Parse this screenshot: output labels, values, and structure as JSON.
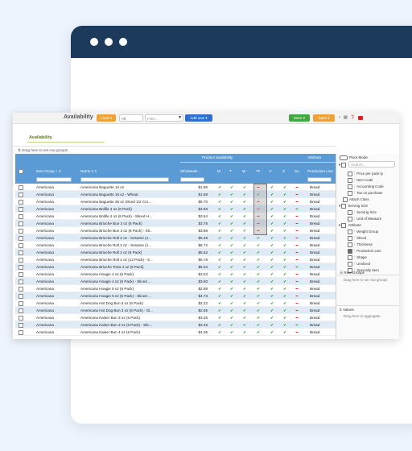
{
  "toolbar": {
    "title": "Availability",
    "load_label": "Load ▾",
    "scope_value": "All",
    "filter_placeholder": "Filter...",
    "add_new_label": "Add new ▾",
    "more_label": "More ▾",
    "save_label": "Save ▾"
  },
  "tab": {
    "label": "Availability"
  },
  "drag_hint": "Drag here to set row groups",
  "grid": {
    "group_headers": {
      "product_availability": "Product availability",
      "attribute": "Attribute"
    },
    "headers": {
      "item_group": "Item Group ↑ ≡",
      "name": "Name ≡ ≡",
      "wholesale": "Wholesale...",
      "days": [
        "M",
        "T",
        "W",
        "Th",
        "F",
        "S",
        "Su"
      ],
      "production_line": "Production Line"
    },
    "rows": [
      {
        "group": "Americana",
        "name": "Americana Baguette 12 oz",
        "price": "$1.80",
        "days": [
          "y",
          "y",
          "y",
          "n",
          "y",
          "y",
          "n"
        ],
        "line": "Bread"
      },
      {
        "group": "Americana",
        "name": "Americana Baguette 16 oz - Wheat",
        "price": "$1.58",
        "days": [
          "y",
          "y",
          "y",
          "y",
          "y",
          "y",
          "n"
        ],
        "line": "Bread"
      },
      {
        "group": "Americana",
        "name": "Americana Baguette 36 oz Sliced 1/2 Cro...",
        "price": "$5.70",
        "days": [
          "y",
          "y",
          "y",
          "n",
          "y",
          "y",
          "n"
        ],
        "line": "Bread"
      },
      {
        "group": "Americana",
        "name": "Americana Bolillo 4 oz (6 Pack)",
        "price": "$3.66",
        "days": [
          "y",
          "y",
          "y",
          "n",
          "y",
          "y",
          "n"
        ],
        "line": "Bread"
      },
      {
        "group": "Americana",
        "name": "Americana Bolillo 4 oz (6 Pack) - Sliced H...",
        "price": "$3.64",
        "days": [
          "y",
          "y",
          "y",
          "n",
          "y",
          "y",
          "n"
        ],
        "line": "Bread"
      },
      {
        "group": "Americana",
        "name": "Americana Brioche Bun 3 oz (6 Pack)",
        "price": "$3.78",
        "days": [
          "y",
          "y",
          "y",
          "n",
          "y",
          "y",
          "n"
        ],
        "line": "Bread"
      },
      {
        "group": "Americana",
        "name": "Americana Brioche Bun 3 oz (6 Pack) - Sli...",
        "price": "$3.96",
        "days": [
          "y",
          "y",
          "y",
          "n",
          "y",
          "y",
          "n"
        ],
        "line": "Bread"
      },
      {
        "group": "Americana",
        "name": "Americana Brioche Roll 2 oz - Sesame (1...",
        "price": "$6.48",
        "days": [
          "y",
          "y",
          "y",
          "y",
          "y",
          "y",
          "n"
        ],
        "line": "Bread"
      },
      {
        "group": "Americana",
        "name": "Americana Brioche Roll 2 oz - Sesame (1...",
        "price": "$6.72",
        "days": [
          "y",
          "y",
          "y",
          "y",
          "y",
          "y",
          "n"
        ],
        "line": "Bread"
      },
      {
        "group": "Americana",
        "name": "Americana Brioche Roll 2 oz (6 Pack)",
        "price": "$5.52",
        "days": [
          "y",
          "y",
          "y",
          "y",
          "y",
          "y",
          "n"
        ],
        "line": "Bread"
      },
      {
        "group": "Americana",
        "name": "Americana Brioche Roll 2 oz (12 Pack) - S...",
        "price": "$5.78",
        "days": [
          "y",
          "y",
          "y",
          "y",
          "y",
          "y",
          "n"
        ],
        "line": "Bread"
      },
      {
        "group": "Americana",
        "name": "Americana Brioche Torta 4 oz (6 Pack)",
        "price": "$5.04",
        "days": [
          "y",
          "y",
          "y",
          "y",
          "y",
          "y",
          "n"
        ],
        "line": "Bread"
      },
      {
        "group": "Americana",
        "name": "Americana Hoagie 4 oz (6 Pack)",
        "price": "$3.53",
        "days": [
          "y",
          "y",
          "y",
          "y",
          "y",
          "y",
          "n"
        ],
        "line": "Bread"
      },
      {
        "group": "Americana",
        "name": "Americana Hoagie 4 oz (6 Pack) - Sliced ...",
        "price": "$3.60",
        "days": [
          "y",
          "y",
          "y",
          "y",
          "y",
          "y",
          "n"
        ],
        "line": "Bread"
      },
      {
        "group": "Americana",
        "name": "Americana Hoagie 5 oz (6 Pack)",
        "price": "$2.98",
        "days": [
          "y",
          "y",
          "y",
          "y",
          "y",
          "y",
          "n"
        ],
        "line": "Bread"
      },
      {
        "group": "Americana",
        "name": "Americana Hoagie 5 oz (6 Pack) - Sliced ...",
        "price": "$4.73",
        "days": [
          "y",
          "y",
          "y",
          "y",
          "y",
          "y",
          "n"
        ],
        "line": "Bread"
      },
      {
        "group": "Americana",
        "name": "Americana Hot Dog Bun 3 oz (6 Pack)",
        "price": "$2.22",
        "days": [
          "y",
          "y",
          "y",
          "y",
          "y",
          "y",
          "n"
        ],
        "line": "Bread"
      },
      {
        "group": "Americana",
        "name": "Americana Hot Dog Bun 3 oz (6 Pack) - Sl...",
        "price": "$2.65",
        "days": [
          "y",
          "y",
          "y",
          "y",
          "y",
          "y",
          "n"
        ],
        "line": "Bread"
      },
      {
        "group": "Americana",
        "name": "Americana Kaiser Bun 3 oz (6 Pack)",
        "price": "$3.25",
        "days": [
          "y",
          "y",
          "y",
          "y",
          "y",
          "y",
          "n"
        ],
        "line": "Bread"
      },
      {
        "group": "Americana",
        "name": "Americana Kaiser Bun 3 oz (6 Pack) - Slic...",
        "price": "$3.45",
        "days": [
          "y",
          "y",
          "y",
          "y",
          "y",
          "y",
          "n"
        ],
        "line": "Bread"
      },
      {
        "group": "Americana",
        "name": "Americana Kaiser Bun 4 oz (6 Pack)",
        "price": "$4.35",
        "days": [
          "y",
          "y",
          "y",
          "y",
          "y",
          "y",
          "n"
        ],
        "line": "Bread"
      }
    ]
  },
  "panel": {
    "pivot_mode": "Pivot Mode",
    "search_placeholder": "Search...",
    "items": [
      {
        "label": "Price per pack ty",
        "checked": false,
        "level": 3
      },
      {
        "label": "Item Code",
        "checked": false,
        "level": 3
      },
      {
        "label": "Accounting Code",
        "checked": false,
        "level": 3
      },
      {
        "label": "Tax on purchase",
        "checked": false,
        "level": 3
      },
      {
        "label": "Attach Class",
        "checked": false,
        "level": 2
      },
      {
        "label": "Serving Size",
        "checked": false,
        "level": 1
      },
      {
        "label": "Serving Size",
        "checked": false,
        "level": 3
      },
      {
        "label": "Unit of Measure",
        "checked": false,
        "level": 3
      },
      {
        "label": "Attribute",
        "checked": false,
        "level": 1
      },
      {
        "label": "Weight Group",
        "checked": false,
        "level": 3
      },
      {
        "label": "Sliced",
        "checked": false,
        "level": 3
      },
      {
        "label": "Thickness",
        "checked": false,
        "level": 3
      },
      {
        "label": "Production Line",
        "checked": true,
        "level": 3
      },
      {
        "label": "Shape",
        "checked": false,
        "level": 3
      },
      {
        "label": "Unsliced",
        "checked": false,
        "level": 3
      },
      {
        "label": "Specialty Item",
        "checked": false,
        "level": 3
      }
    ],
    "row_groups_label": "Row Groups",
    "row_groups_hint": "Drag here to set row groups",
    "values_label": "Values",
    "values_hint": "Drag here to aggregate"
  }
}
